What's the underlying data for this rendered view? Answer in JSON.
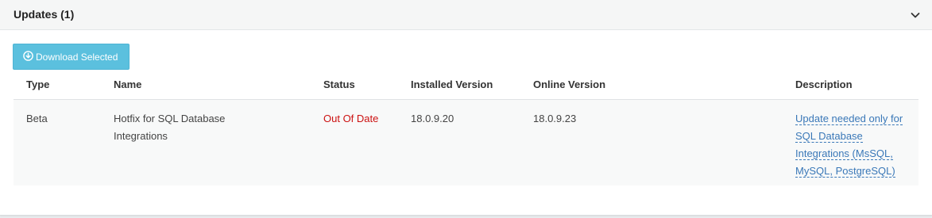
{
  "panel": {
    "title": "Updates (1)",
    "toggle_icon": "chevron-down-icon"
  },
  "actions": {
    "download_label": "Download Selected",
    "download_icon": "circle-arrow-down-icon",
    "download_color": "#5bc0de"
  },
  "table": {
    "headers": {
      "type": "Type",
      "name": "Name",
      "status": "Status",
      "installed": "Installed Version",
      "online": "Online Version",
      "description": "Description"
    },
    "rows": [
      {
        "type": "Beta",
        "name": "Hotfix for SQL Database Integrations",
        "status": "Out Of Date",
        "installed": "18.0.9.20",
        "online": "18.0.9.23",
        "description": "Update needed only for SQL Database Integrations (MsSQL, MySQL, PostgreSQL)"
      }
    ]
  },
  "colors": {
    "status_out_of_date": "#cc1111",
    "link": "#3a78b8"
  }
}
